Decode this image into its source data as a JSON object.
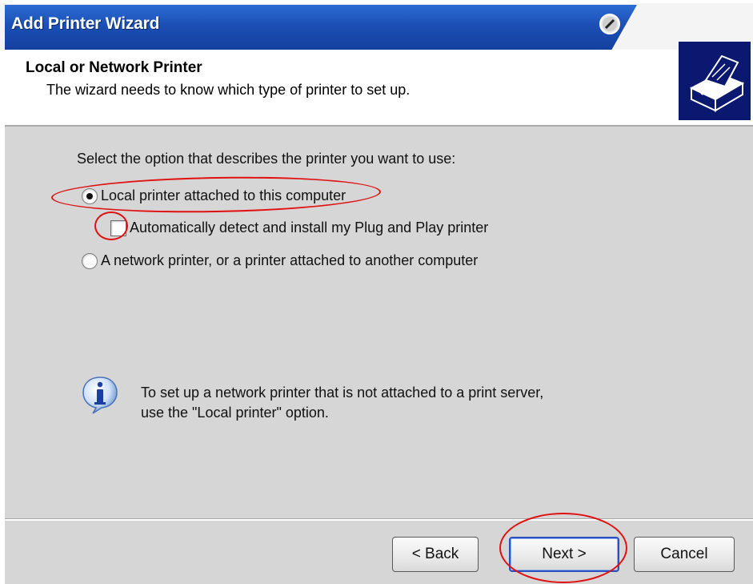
{
  "window": {
    "title": "Add Printer Wizard"
  },
  "header": {
    "title": "Local or Network Printer",
    "subtitle": "The wizard needs to know which type of printer to set up.",
    "icon": "printer-icon"
  },
  "content": {
    "prompt": "Select the option that describes the printer you want to use:",
    "options": [
      {
        "label": "Local printer attached to this computer",
        "selected": true
      },
      {
        "label": "A network printer, or a printer attached to another computer",
        "selected": false
      }
    ],
    "auto_detect": {
      "label": "Automatically detect and install my Plug and Play printer",
      "checked": false
    },
    "info": {
      "icon": "info-icon",
      "line1": "To set up a network printer that is not attached to a print server,",
      "line2": "use the \"Local printer\" option."
    }
  },
  "buttons": {
    "back": "< Back",
    "next": "Next >",
    "cancel": "Cancel"
  },
  "colors": {
    "titlebar": "#1c4fb5",
    "annotation": "#e01010",
    "dialog_bg": "#d6d6d6"
  }
}
